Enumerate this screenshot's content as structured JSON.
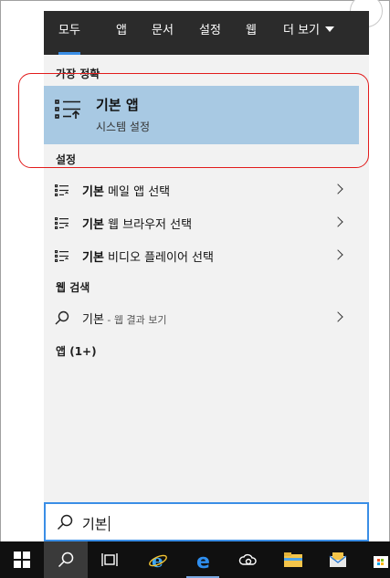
{
  "tabs": [
    {
      "label": "모두",
      "active": true
    },
    {
      "label": "앱",
      "active": false
    },
    {
      "label": "문서",
      "active": false
    },
    {
      "label": "설정",
      "active": false
    },
    {
      "label": "웹",
      "active": false
    },
    {
      "label": "더 보기",
      "active": false
    }
  ],
  "best_match": {
    "header": "가장 정확",
    "title": "기본 앱",
    "subtitle": "시스템 설정",
    "icon": "default-apps-icon"
  },
  "settings": {
    "header": "설정",
    "items": [
      {
        "bold": "기본",
        "rest": " 메일 앱 선택",
        "icon": "settings-list-icon"
      },
      {
        "bold": "기본",
        "rest": " 웹 브라우저 선택",
        "icon": "settings-list-icon"
      },
      {
        "bold": "기본",
        "rest": " 비디오 플레이어 선택",
        "icon": "settings-list-icon"
      }
    ]
  },
  "web": {
    "header": "웹 검색",
    "item": {
      "bold": "기본",
      "rest": " - 웹 결과 보기",
      "icon": "search-icon"
    }
  },
  "apps": {
    "header": "앱 (1+)"
  },
  "search": {
    "value": "기본",
    "icon": "search-icon"
  },
  "taskbar": {
    "items": [
      "windows-start-icon",
      "search-icon",
      "task-view-icon",
      "internet-explorer-icon",
      "edge-icon",
      "onedrive-icon",
      "file-explorer-icon",
      "mail-icon",
      "store-icon"
    ]
  },
  "colors": {
    "topbar": "#2b2b2b",
    "accent": "#3a8ee6",
    "selection": "#a8c9e3",
    "panel": "#f2f2f2",
    "annotation": "#e21b1b",
    "taskbar": "#101010"
  }
}
